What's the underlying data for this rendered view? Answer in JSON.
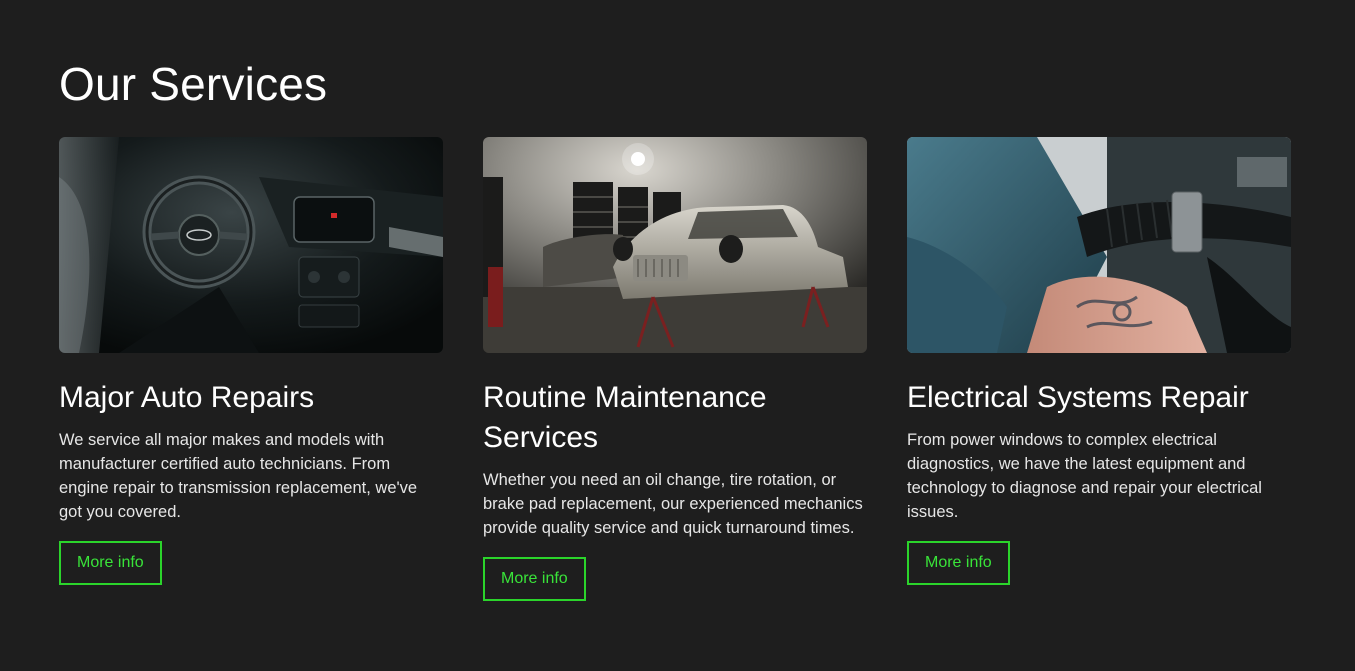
{
  "section": {
    "title": "Our Services"
  },
  "colors": {
    "background": "#1e1e1e",
    "accent": "#2bd42b",
    "text": "#ffffff"
  },
  "services": [
    {
      "title": "Major Auto Repairs",
      "description": "We service all major makes and models with manufacturer certified auto technicians. From engine repair to transmission replacement, we've got you covered.",
      "button_label": "More info",
      "image": "car-interior-dashboard"
    },
    {
      "title": "Routine Maintenance Services",
      "description": "Whether you need an oil change, tire rotation, or brake pad replacement, our experienced mechanics provide quality service and quick turnaround times.",
      "button_label": "More info",
      "image": "vintage-car-in-garage"
    },
    {
      "title": "Electrical Systems Repair",
      "description": "From power windows to complex electrical diagnostics, we have the latest equipment and technology to diagnose and repair your electrical issues.",
      "button_label": "More info",
      "image": "mechanic-tattooed-arms-engine"
    }
  ]
}
